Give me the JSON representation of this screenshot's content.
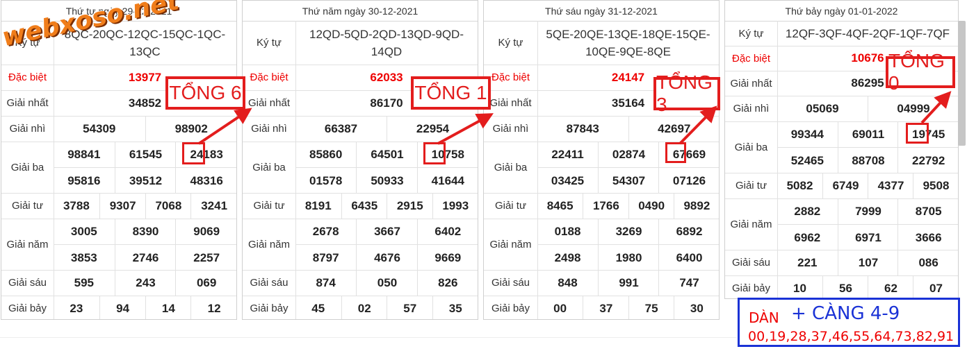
{
  "panels": [
    {
      "date": "Thứ tư ngày 29-12-2021",
      "code": "8QC-20QC-12QC-15QC-1QC-13QC",
      "special": "13977",
      "first": "34852",
      "second": [
        "54309",
        "98902"
      ],
      "third": [
        "98841",
        "61545",
        "24183",
        "95816",
        "39512",
        "48316"
      ],
      "fourth": [
        "3788",
        "9307",
        "7068",
        "3241"
      ],
      "fifth": [
        "3005",
        "8390",
        "9069",
        "3853",
        "2746",
        "2257"
      ],
      "sixth": [
        "595",
        "243",
        "069"
      ],
      "seventh": [
        "23",
        "94",
        "14",
        "12"
      ],
      "tong": "TỔNG 6"
    },
    {
      "date": "Thứ năm ngày 30-12-2021",
      "code": "12QD-5QD-2QD-13QD-9QD-14QD",
      "special": "62033",
      "first": "86170",
      "second": [
        "66387",
        "22954"
      ],
      "third": [
        "85860",
        "64501",
        "10758",
        "01578",
        "50933",
        "41644"
      ],
      "fourth": [
        "8191",
        "6435",
        "2915",
        "1993"
      ],
      "fifth": [
        "2678",
        "3667",
        "6402",
        "8797",
        "4676",
        "9669"
      ],
      "sixth": [
        "874",
        "050",
        "826"
      ],
      "seventh": [
        "45",
        "02",
        "57",
        "35"
      ],
      "tong": "TỔNG 1"
    },
    {
      "date": "Thứ sáu ngày 31-12-2021",
      "code": "5QE-20QE-13QE-18QE-15QE-10QE-9QE-8QE",
      "special": "24147",
      "first": "35164",
      "second": [
        "87843",
        "42697"
      ],
      "third": [
        "22411",
        "02874",
        "67669",
        "03425",
        "54307",
        "07126"
      ],
      "fourth": [
        "8465",
        "1766",
        "0490",
        "9892"
      ],
      "fifth": [
        "0188",
        "3269",
        "6892",
        "2498",
        "1980",
        "6400"
      ],
      "sixth": [
        "848",
        "991",
        "747"
      ],
      "seventh": [
        "00",
        "37",
        "75",
        "30"
      ],
      "tong": "TỔNG 3"
    },
    {
      "date": "Thứ bảy ngày 01-01-2022",
      "code": "12QF-3QF-4QF-2QF-1QF-7QF",
      "special": "10676",
      "first": "86295",
      "second": [
        "05069",
        "04999"
      ],
      "third": [
        "99344",
        "69011",
        "19745",
        "52465",
        "88708",
        "22792"
      ],
      "fourth": [
        "5082",
        "6749",
        "4377",
        "9508"
      ],
      "fifth": [
        "2882",
        "7999",
        "8705",
        "6962",
        "6971",
        "3666"
      ],
      "sixth": [
        "221",
        "107",
        "086"
      ],
      "seventh": [
        "10",
        "56",
        "62",
        "07"
      ],
      "tong": "TỔNG 0"
    }
  ],
  "labels": {
    "code": "Ký tự",
    "special": "Đặc biệt",
    "first": "Giải nhất",
    "second": "Giải nhì",
    "third": "Giải ba",
    "fourth": "Giải tư",
    "fifth": "Giải năm",
    "sixth": "Giải sáu",
    "seventh": "Giải bảy"
  },
  "watermark": "webxoso.net",
  "dan": {
    "label": "DÀN",
    "cang": "+ CÀNG 4-9",
    "numbers": "00,19,28,37,46,55,64,73,82,91"
  },
  "colors": {
    "red": "#e31d1d",
    "blue": "#1a32d6",
    "logo": "#f07d1a"
  }
}
